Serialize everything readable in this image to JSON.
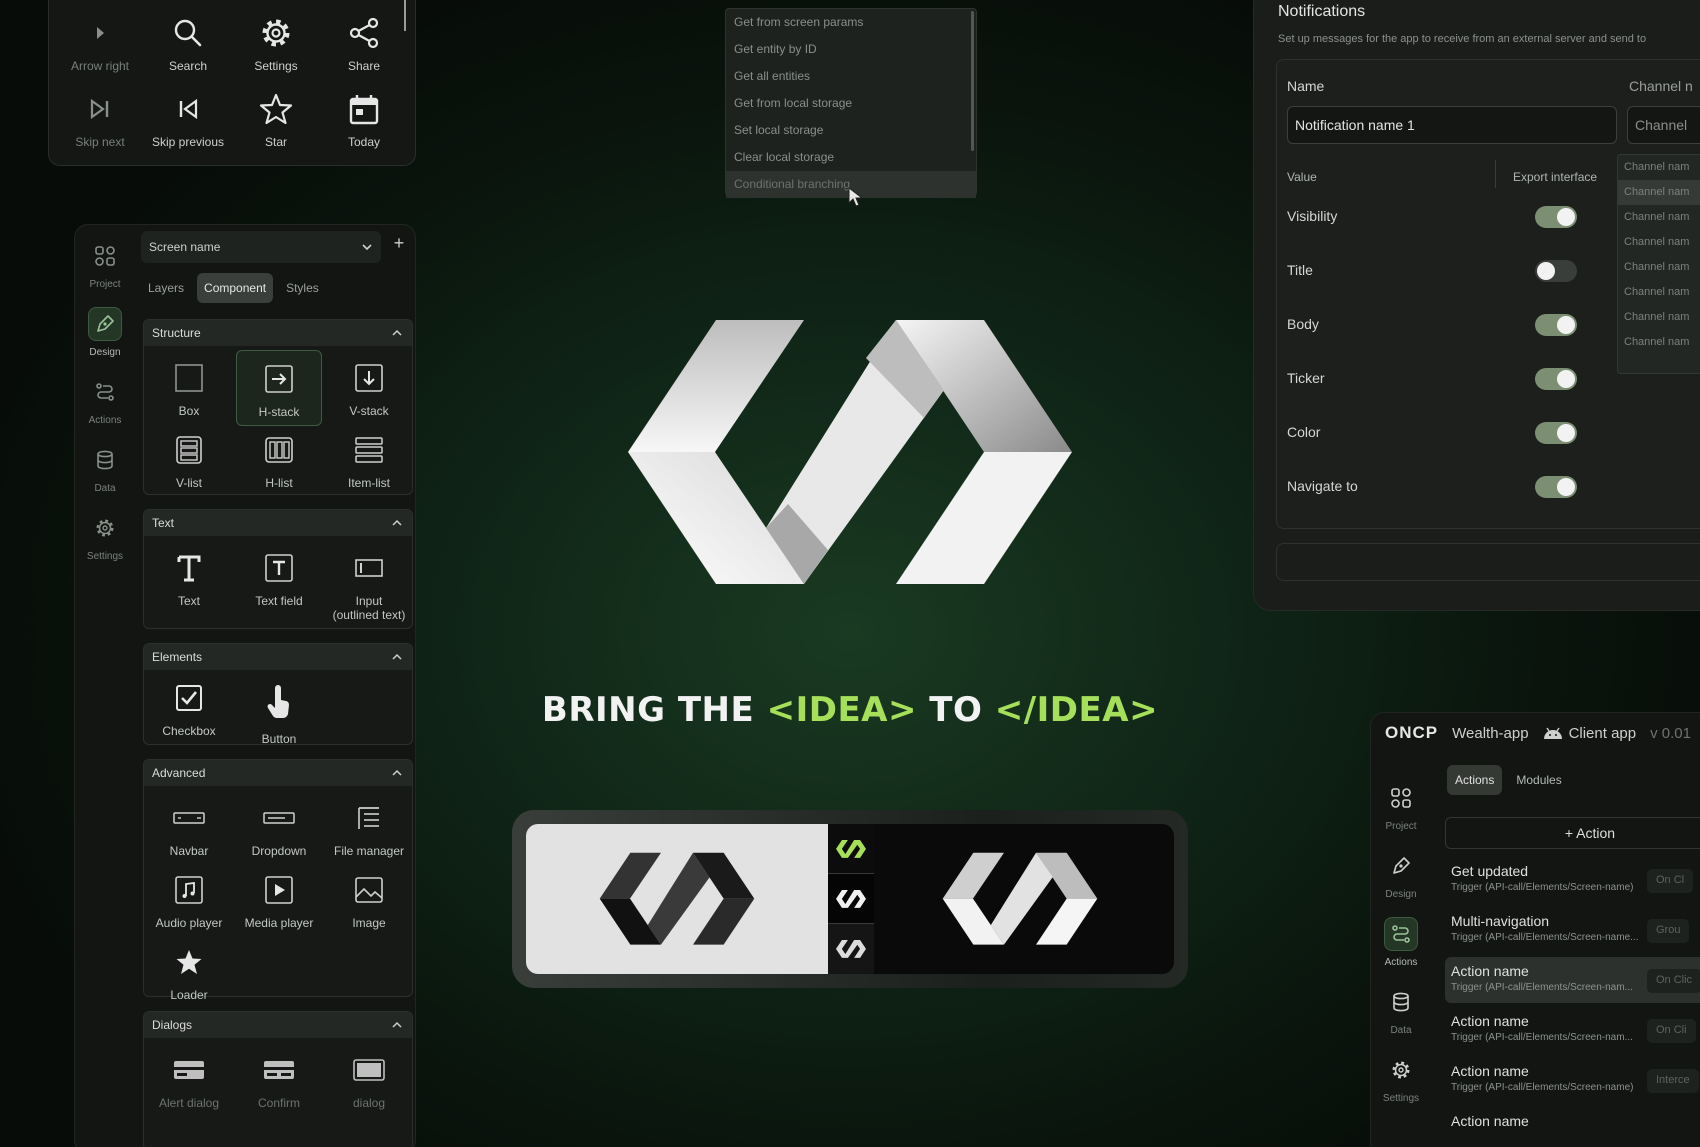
{
  "icon_grid": {
    "items": [
      {
        "label": "Arrow right",
        "icon": "arrow-right-icon",
        "dim": true
      },
      {
        "label": "Search",
        "icon": "search-icon"
      },
      {
        "label": "Settings",
        "icon": "gear-icon"
      },
      {
        "label": "Share",
        "icon": "share-icon"
      },
      {
        "label": "Skip next",
        "icon": "skip-next-icon",
        "dim": true
      },
      {
        "label": "Skip previous",
        "icon": "skip-previous-icon"
      },
      {
        "label": "Star",
        "icon": "star-icon"
      },
      {
        "label": "Today",
        "icon": "calendar-icon"
      }
    ]
  },
  "dropdown": {
    "items": [
      "Get from screen params",
      "Get entity by ID",
      "Get all entities",
      "Get from local storage",
      "Set local storage",
      "Clear local storage",
      "Conditional branching"
    ],
    "highlighted": "Conditional branching"
  },
  "sidebar": {
    "nav": [
      {
        "label": "Project",
        "icon": "project-icon"
      },
      {
        "label": "Design",
        "icon": "pen-icon",
        "active": true
      },
      {
        "label": "Actions",
        "icon": "actions-icon"
      },
      {
        "label": "Data",
        "icon": "database-icon"
      },
      {
        "label": "Settings",
        "icon": "gear-icon"
      }
    ],
    "screen_select": "Screen name",
    "add_label": "+",
    "tabs": [
      "Layers",
      "Component",
      "Styles"
    ],
    "active_tab": "Component",
    "sections": {
      "structure": {
        "title": "Structure",
        "items": [
          "Box",
          "H-stack",
          "V-stack",
          "V-list",
          "H-list",
          "Item-list"
        ]
      },
      "text": {
        "title": "Text",
        "items": [
          "Text",
          "Text field",
          "Input\n(outlined text)"
        ]
      },
      "elements": {
        "title": "Elements",
        "items": [
          "Checkbox",
          "Button"
        ]
      },
      "advanced": {
        "title": "Advanced",
        "items": [
          "Navbar",
          "Dropdown",
          "File manager",
          "Audio player",
          "Media player",
          "Image",
          "Loader"
        ]
      },
      "dialogs": {
        "title": "Dialogs",
        "items": [
          "Alert dialog",
          "Confirm",
          "dialog"
        ]
      }
    }
  },
  "notifications": {
    "title": "Notifications",
    "subtitle": "Set up messages for the app to receive from an external server and send to",
    "name_label": "Name",
    "channel_label": "Channel n",
    "name_value": "Notification name 1",
    "channel_value": "Channel",
    "value_label": "Value",
    "export_label": "Export interface",
    "fields": [
      {
        "label": "Visibility",
        "on": true
      },
      {
        "label": "Title",
        "on": false
      },
      {
        "label": "Body",
        "on": true
      },
      {
        "label": "Ticker",
        "on": true
      },
      {
        "label": "Color",
        "on": true
      },
      {
        "label": "Navigate to",
        "on": true
      }
    ],
    "channel_items": [
      "Channel nam",
      "Channel nam",
      "Channel nam",
      "Channel nam",
      "Channel nam",
      "Channel nam",
      "Channel nam",
      "Channel nam"
    ]
  },
  "hero": {
    "tagline": {
      "p1": "BRING THE ",
      "g1": "<IDEA>",
      "p2": " TO ",
      "g2": "</IDEA>"
    }
  },
  "actions_panel": {
    "logo": "ONCP",
    "project": "Wealth-app",
    "client": "Client app",
    "version": "v 0.01",
    "nav": [
      {
        "label": "Project",
        "icon": "project-icon"
      },
      {
        "label": "Design",
        "icon": "pen-icon"
      },
      {
        "label": "Actions",
        "icon": "actions-icon",
        "active": true
      },
      {
        "label": "Data",
        "icon": "database-icon"
      },
      {
        "label": "Settings",
        "icon": "gear-icon"
      }
    ],
    "tabs": [
      "Actions",
      "Modules"
    ],
    "active_tab": "Actions",
    "add_label": "+ Action",
    "rows": [
      {
        "title": "Get updated",
        "sub": "Trigger (API-call/Elements/Screen-name)",
        "chip": "On Cl"
      },
      {
        "title": "Multi-navigation",
        "sub": "Trigger (API-call/Elements/Screen-name...",
        "chip": "Grou"
      },
      {
        "title": "Action name",
        "sub": "Trigger (API-call/Elements/Screen-nam...",
        "chip": "On Clic",
        "selected": true
      },
      {
        "title": "Action name",
        "sub": "Trigger (API-call/Elements/Screen-nam...",
        "chip": "On Cli"
      },
      {
        "title": "Action name",
        "sub": "Trigger (API-call/Elements/Screen-name)",
        "chip": "Interce"
      },
      {
        "title": "Action name",
        "sub": "",
        "chip": ""
      }
    ]
  }
}
